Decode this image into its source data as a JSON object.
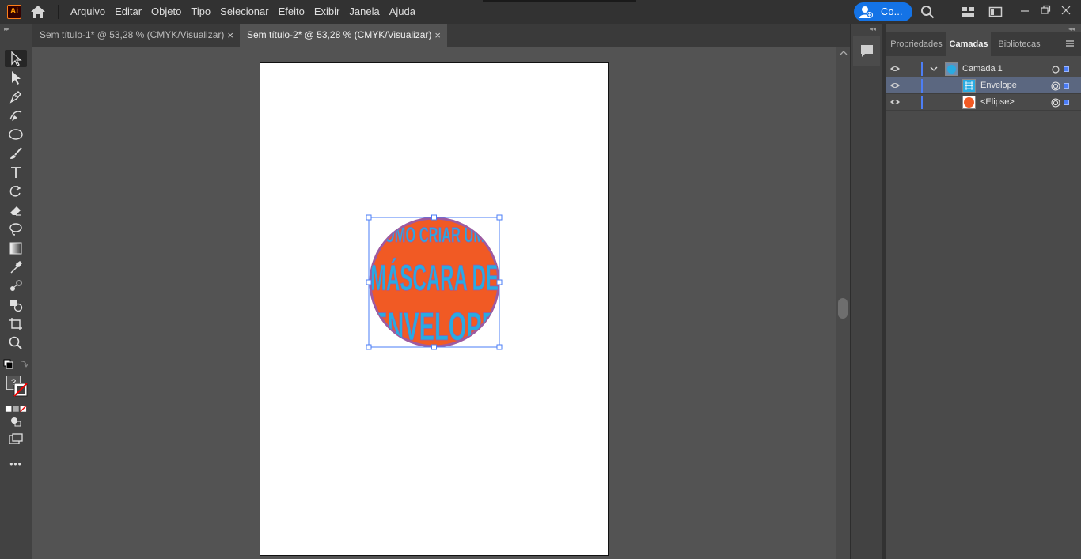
{
  "app": {
    "logo_text": "Ai"
  },
  "menu": [
    "Arquivo",
    "Editar",
    "Objeto",
    "Tipo",
    "Selecionar",
    "Efeito",
    "Exibir",
    "Janela",
    "Ajuda"
  ],
  "cloud": {
    "label": "Co..."
  },
  "tabs": [
    {
      "label": "Sem título-1* @ 53,28 % (CMYK/Visualizar)",
      "close": "×",
      "active": false
    },
    {
      "label": "Sem título-2* @ 53,28 % (CMYK/Visualizar)",
      "close": "×",
      "active": true
    }
  ],
  "artwork": {
    "lines": [
      "COMO CRIAR UMA",
      "MÁSCARA DE",
      "ENVELOPE"
    ],
    "text_color": "#29abe2",
    "fill_color": "#f15a24",
    "stroke_color": "#9e5aa0"
  },
  "panel": {
    "tabs": [
      "Propriedades",
      "Camadas",
      "Bibliotecas"
    ],
    "active_tab": "Camadas",
    "layers": [
      {
        "name": "Camada 1",
        "type": "layer",
        "selected": false
      },
      {
        "name": "Envelope",
        "type": "envelope",
        "selected": true
      },
      {
        "name": "<Elipse>",
        "type": "ellipse",
        "selected": false
      }
    ]
  },
  "toolbar": {
    "more_label": "•••",
    "question_label": "?"
  },
  "colors": {
    "accent": "#1473e6",
    "selection": "#4a7cf7",
    "layer_color": "#4d7ef5"
  }
}
